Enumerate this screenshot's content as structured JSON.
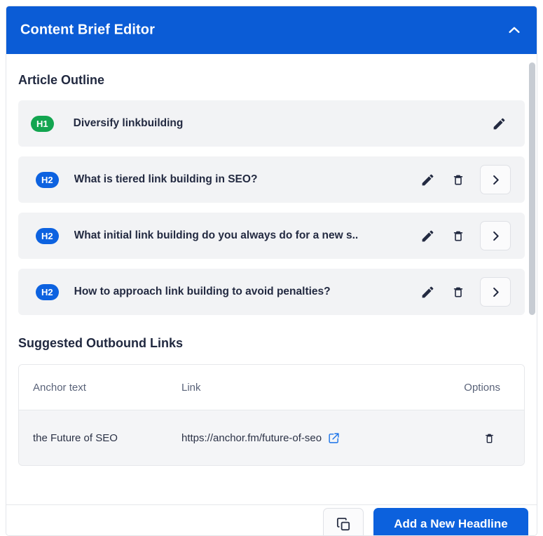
{
  "header": {
    "title": "Content Brief Editor",
    "collapse_icon": "chevron-up-icon"
  },
  "outline": {
    "section_title": "Article Outline",
    "rows": [
      {
        "level": "H1",
        "text": "Diversify linkbuilding",
        "badge_color": "#13a550",
        "actions": [
          "edit-icon"
        ]
      },
      {
        "level": "H2",
        "text": "What is tiered link building in SEO?",
        "badge_color": "#0d62e0",
        "actions": [
          "edit-icon",
          "delete-icon",
          "expand-icon"
        ]
      },
      {
        "level": "H2",
        "text": "What initial link building do you always do for a new s..",
        "badge_color": "#0d62e0",
        "actions": [
          "edit-icon",
          "delete-icon",
          "expand-icon"
        ]
      },
      {
        "level": "H2",
        "text": "How to approach link building to avoid penalties?",
        "badge_color": "#0d62e0",
        "actions": [
          "edit-icon",
          "delete-icon",
          "expand-icon"
        ]
      }
    ]
  },
  "links": {
    "section_title": "Suggested Outbound Links",
    "columns": [
      "Anchor text",
      "Link",
      "Options"
    ],
    "rows": [
      {
        "anchor_text": "the Future of SEO",
        "link": "https://anchor.fm/future-of-seo",
        "external_icon": "external-link-icon",
        "option_icon": "delete-icon"
      }
    ]
  },
  "footer": {
    "copy_icon": "copy-icon",
    "add_headline_label": "Add a New Headline",
    "primary_color": "#0c61dd"
  }
}
